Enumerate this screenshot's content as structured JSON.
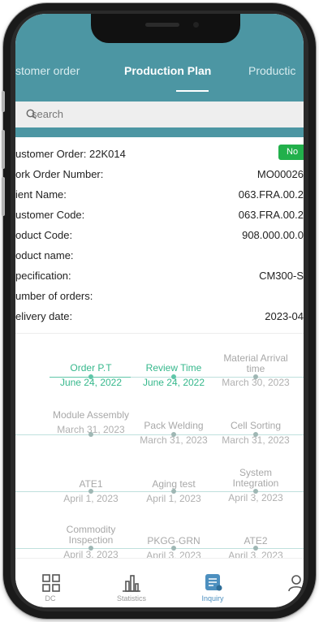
{
  "tabs": [
    {
      "label": "stomer order"
    },
    {
      "label": "Production Plan"
    },
    {
      "label": "Productic"
    }
  ],
  "search": {
    "placeholder": "search"
  },
  "status_badge": "No",
  "details": [
    {
      "label": "ustomer Order:  22K014",
      "value": ""
    },
    {
      "label": "ork Order Number:",
      "value": "MO00026"
    },
    {
      "label": "ient Name:",
      "value": "063.FRA.00.2"
    },
    {
      "label": "ustomer Code:",
      "value": "063.FRA.00.2"
    },
    {
      "label": "oduct Code:",
      "value": "908.000.00.0"
    },
    {
      "label": "oduct name:",
      "value": ""
    },
    {
      "label": "pecification:",
      "value": "CM300-S"
    },
    {
      "label": "umber of orders:",
      "value": ""
    },
    {
      "label": "elivery date:",
      "value": "2023-04"
    }
  ],
  "timeline": [
    {
      "name": "Order P.T",
      "date": "June 24, 2022",
      "done": true
    },
    {
      "name": "Review Time",
      "date": "June 24, 2022",
      "done": true
    },
    {
      "name": "Material Arrival time",
      "date": "March 30, 2023",
      "done": false
    },
    {
      "name": "Module Assembly",
      "date": "March 31, 2023",
      "done": false
    },
    {
      "name": "Pack Welding",
      "date": "March 31, 2023",
      "done": false
    },
    {
      "name": "Cell Sorting",
      "date": "March 31, 2023",
      "done": false
    },
    {
      "name": "ATE1",
      "date": "April 1, 2023",
      "done": false
    },
    {
      "name": "Aging test",
      "date": "April 1, 2023",
      "done": false
    },
    {
      "name": "System Integration",
      "date": "April 3, 2023",
      "done": false
    },
    {
      "name": "Commodity Inspection",
      "date": "April 3, 2023",
      "done": false
    },
    {
      "name": "PKGG-GRN",
      "date": "April 3, 2023",
      "done": false
    },
    {
      "name": "ATE2",
      "date": "April 3, 2023",
      "done": false
    }
  ],
  "nav": [
    {
      "label": "DC",
      "icon": "grid-icon"
    },
    {
      "label": "Statistics",
      "icon": "bar-chart-icon"
    },
    {
      "label": "Inquiry",
      "icon": "inquiry-document-icon",
      "active": true
    },
    {
      "label": "Ac",
      "icon": "person-icon"
    }
  ],
  "colors": {
    "header": "#4c96a3",
    "badge": "#22b04b",
    "done": "#36b88c",
    "nav_active": "#4c8fbf"
  }
}
